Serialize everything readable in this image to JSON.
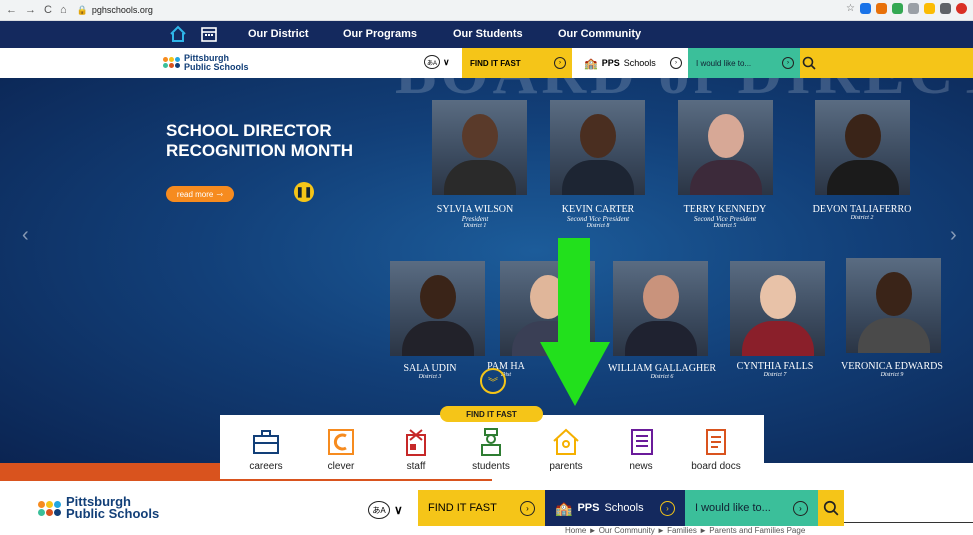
{
  "browser": {
    "back": "←",
    "forward": "→",
    "reload": "C",
    "home": "⌂",
    "url": "pghschools.org"
  },
  "topnav": {
    "items": [
      "Our District",
      "Our Programs",
      "Our Students",
      "Our Community"
    ]
  },
  "logo": {
    "line1": "Pittsburgh",
    "line2": "Public Schools"
  },
  "utility": {
    "find_it_fast": "FIND IT FAST",
    "pps_schools_bold": "PPS",
    "pps_schools_rest": "Schools",
    "would_like": "I would like to..."
  },
  "hero": {
    "bg_title": "BOARD of DIRECTORS",
    "headline_line1": "SCHOOL DIRECTOR",
    "headline_line2": "RECOGNITION MONTH",
    "read_more": "read more",
    "directors": [
      {
        "name": "SYLVIA WILSON",
        "title": "President",
        "district": "District 1"
      },
      {
        "name": "KEVIN CARTER",
        "title": "Second Vice President",
        "district": "District 8"
      },
      {
        "name": "TERRY KENNEDY",
        "title": "Second Vice President",
        "district": "District 5"
      },
      {
        "name": "DEVON TALIAFERRO",
        "title": "",
        "district": "District 2"
      },
      {
        "name": "SALA UDIN",
        "title": "",
        "district": "District 3"
      },
      {
        "name": "PAM HA",
        "title": "",
        "district": "Dist"
      },
      {
        "name": "WILLIAM GALLAGHER",
        "title": "",
        "district": "District 6"
      },
      {
        "name": "CYNTHIA FALLS",
        "title": "",
        "district": "District 7"
      },
      {
        "name": "VERONICA EDWARDS",
        "title": "",
        "district": "District 9"
      }
    ]
  },
  "find_it_fast_panel": {
    "label": "FIND IT FAST",
    "items": [
      "careers",
      "clever",
      "staff",
      "students",
      "parents",
      "news",
      "board docs"
    ]
  },
  "breadcrumb": "Home ► Our Community ► Families ► Parents and Families Page",
  "colors": {
    "navy": "#14295e",
    "yellow": "#f5c518",
    "teal": "#3bbf9a",
    "orange": "#f68b1f",
    "green_arrow": "#22e01c"
  }
}
